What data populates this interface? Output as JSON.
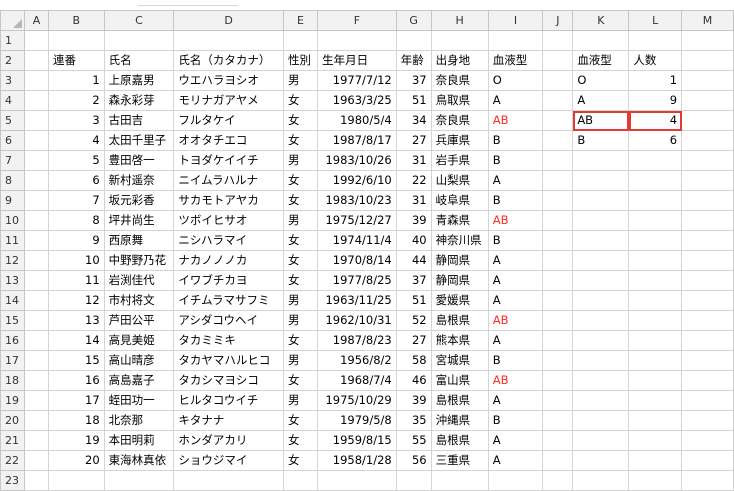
{
  "columns": [
    "A",
    "B",
    "C",
    "D",
    "E",
    "F",
    "G",
    "H",
    "I",
    "J",
    "K",
    "L",
    "M"
  ],
  "colors": {
    "red_text": "#ff2b2b",
    "highlight_border": "#e53935",
    "header_bg": "#f2f2f2",
    "grid_line": "#d4d4d4"
  },
  "header_row": {
    "B": "連番",
    "C": "氏名",
    "D": "氏名（カタカナ）",
    "E": "性別",
    "F": "生年月日",
    "G": "年齢",
    "H": "出身地",
    "I": "血液型",
    "K": "血液型",
    "L": "人数"
  },
  "data_rows": [
    {
      "B": "1",
      "C": "上原嘉男",
      "D": "ウエハラヨシオ",
      "E": "男",
      "F": "1977/7/12",
      "G": "37",
      "H": "奈良県",
      "I": "O"
    },
    {
      "B": "2",
      "C": "森永彩芽",
      "D": "モリナガアヤメ",
      "E": "女",
      "F": "1963/3/25",
      "G": "51",
      "H": "鳥取県",
      "I": "A"
    },
    {
      "B": "3",
      "C": "古田吉",
      "D": "フルタケイ",
      "E": "女",
      "F": "1980/5/4",
      "G": "34",
      "H": "奈良県",
      "I": "AB"
    },
    {
      "B": "4",
      "C": "太田千里子",
      "D": "オオタチエコ",
      "E": "女",
      "F": "1987/8/17",
      "G": "27",
      "H": "兵庫県",
      "I": "B"
    },
    {
      "B": "5",
      "C": "豊田啓一",
      "D": "トヨダケイイチ",
      "E": "男",
      "F": "1983/10/26",
      "G": "31",
      "H": "岩手県",
      "I": "B"
    },
    {
      "B": "6",
      "C": "新村遥奈",
      "D": "ニイムラハルナ",
      "E": "女",
      "F": "1992/6/10",
      "G": "22",
      "H": "山梨県",
      "I": "A"
    },
    {
      "B": "7",
      "C": "坂元彩香",
      "D": "サカモトアヤカ",
      "E": "女",
      "F": "1983/10/23",
      "G": "31",
      "H": "岐阜県",
      "I": "B"
    },
    {
      "B": "8",
      "C": "坪井尚生",
      "D": "ツボイヒサオ",
      "E": "男",
      "F": "1975/12/27",
      "G": "39",
      "H": "青森県",
      "I": "AB"
    },
    {
      "B": "9",
      "C": "西原舞",
      "D": "ニシハラマイ",
      "E": "女",
      "F": "1974/11/4",
      "G": "40",
      "H": "神奈川県",
      "I": "B"
    },
    {
      "B": "10",
      "C": "中野野乃花",
      "D": "ナカノノノカ",
      "E": "女",
      "F": "1970/8/14",
      "G": "44",
      "H": "静岡県",
      "I": "A"
    },
    {
      "B": "11",
      "C": "岩渕佳代",
      "D": "イワブチカヨ",
      "E": "女",
      "F": "1977/8/25",
      "G": "37",
      "H": "静岡県",
      "I": "A"
    },
    {
      "B": "12",
      "C": "市村将文",
      "D": "イチムラマサフミ",
      "E": "男",
      "F": "1963/11/25",
      "G": "51",
      "H": "愛媛県",
      "I": "A"
    },
    {
      "B": "13",
      "C": "芦田公平",
      "D": "アシダコウヘイ",
      "E": "男",
      "F": "1962/10/31",
      "G": "52",
      "H": "島根県",
      "I": "AB"
    },
    {
      "B": "14",
      "C": "高見美姫",
      "D": "タカミミキ",
      "E": "女",
      "F": "1987/8/23",
      "G": "27",
      "H": "熊本県",
      "I": "A"
    },
    {
      "B": "15",
      "C": "高山晴彦",
      "D": "タカヤマハルヒコ",
      "E": "男",
      "F": "1956/8/2",
      "G": "58",
      "H": "宮城県",
      "I": "B"
    },
    {
      "B": "16",
      "C": "高島嘉子",
      "D": "タカシマヨシコ",
      "E": "女",
      "F": "1968/7/4",
      "G": "46",
      "H": "富山県",
      "I": "AB"
    },
    {
      "B": "17",
      "C": "蛭田功一",
      "D": "ヒルタコウイチ",
      "E": "男",
      "F": "1975/10/29",
      "G": "39",
      "H": "島根県",
      "I": "A"
    },
    {
      "B": "18",
      "C": "北奈那",
      "D": "キタナナ",
      "E": "女",
      "F": "1979/5/8",
      "G": "35",
      "H": "沖縄県",
      "I": "B"
    },
    {
      "B": "19",
      "C": "本田明莉",
      "D": "ホンダアカリ",
      "E": "女",
      "F": "1959/8/15",
      "G": "55",
      "H": "島根県",
      "I": "A"
    },
    {
      "B": "20",
      "C": "東海林真依",
      "D": "ショウジマイ",
      "E": "女",
      "F": "1958/1/28",
      "G": "56",
      "H": "三重県",
      "I": "A"
    }
  ],
  "summary_rows": [
    {
      "K": "O",
      "L": "1"
    },
    {
      "K": "A",
      "L": "9"
    },
    {
      "K": "AB",
      "L": "4"
    },
    {
      "K": "B",
      "L": "6"
    }
  ],
  "red_value": "AB",
  "highlighted_row": "5"
}
